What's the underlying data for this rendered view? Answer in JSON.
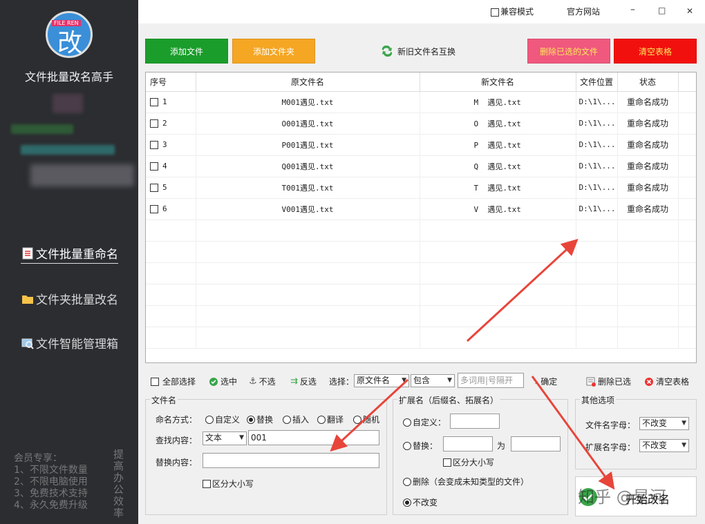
{
  "app": {
    "logo_badge": "FILE REN",
    "logo_char": "改",
    "title": "文件批量改名高手"
  },
  "nav": [
    {
      "label": "文件批量重命名",
      "icon": "document-list-icon",
      "active": true
    },
    {
      "label": "文件夹批量改名",
      "icon": "folder-icon",
      "active": false
    },
    {
      "label": "文件智能管理箱",
      "icon": "image-search-icon",
      "active": false
    }
  ],
  "member": {
    "heading": "会员专享：",
    "lines": [
      "1、不限文件数量",
      "2、不限电脑使用",
      "3、免费技术支持",
      "4、永久免费升级"
    ],
    "promo": "提高办公效率"
  },
  "titlebar": {
    "compat_label": "兼容模式",
    "website_label": "官方网站",
    "minimize": "–",
    "maximize": "□",
    "close": "✕"
  },
  "toolbar": {
    "add_file": "添加文件",
    "add_folder": "添加文件夹",
    "swap_names": "新旧文件名互换",
    "delete_selected": "删除已选的文件",
    "clear_table": "清空表格"
  },
  "table": {
    "headers": [
      "序号",
      "原文件名",
      "新文件名",
      "文件位置",
      "状态"
    ],
    "rows": [
      {
        "num": "1",
        "orig": "M001遇见.txt",
        "new_prefix": "M",
        "new_name": "遇见.txt",
        "loc": "D:\\1\\...",
        "status": "重命名成功"
      },
      {
        "num": "2",
        "orig": "O001遇见.txt",
        "new_prefix": "O",
        "new_name": "遇见.txt",
        "loc": "D:\\1\\...",
        "status": "重命名成功"
      },
      {
        "num": "3",
        "orig": "P001遇见.txt",
        "new_prefix": "P",
        "new_name": "遇见.txt",
        "loc": "D:\\1\\...",
        "status": "重命名成功"
      },
      {
        "num": "4",
        "orig": "Q001遇见.txt",
        "new_prefix": "Q",
        "new_name": "遇见.txt",
        "loc": "D:\\1\\...",
        "status": "重命名成功"
      },
      {
        "num": "5",
        "orig": "T001遇见.txt",
        "new_prefix": "T",
        "new_name": "遇见.txt",
        "loc": "D:\\1\\...",
        "status": "重命名成功"
      },
      {
        "num": "6",
        "orig": "V001遇见.txt",
        "new_prefix": "V",
        "new_name": "遇见.txt",
        "loc": "D:\\1\\...",
        "status": "重命名成功"
      }
    ]
  },
  "bottombar": {
    "select_all": "全部选择",
    "select": "选中",
    "deselect": "不选",
    "invert": "反选",
    "choose_label": "选择：",
    "field_value": "原文件名",
    "match_value": "包含",
    "keyword_placeholder": "多词用|号隔开",
    "confirm": "确定",
    "delete_selected": "删除已选",
    "clear_table": "清空表格"
  },
  "filename_panel": {
    "title": "文件名",
    "mode_label": "命名方式：",
    "modes": [
      "自定义",
      "替换",
      "插入",
      "翻译",
      "随机"
    ],
    "mode_selected": "替换",
    "find_label": "查找内容：",
    "find_type": "文本",
    "find_value": "001",
    "replace_label": "替换内容：",
    "replace_value": "",
    "case_label": "区分大小写"
  },
  "ext_panel": {
    "title": "扩展名（后缀名、拓展名）",
    "custom": "自定义：",
    "replace": "替换：",
    "to": "为",
    "case": "区分大小写",
    "delete": "删除（会变成未知类型的文件）",
    "unchanged": "不改变"
  },
  "other_panel": {
    "title": "其他选项",
    "filename_case_label": "文件名字母：",
    "filename_case_value": "不改变",
    "ext_case_label": "扩展名字母：",
    "ext_case_value": "不改变"
  },
  "start": {
    "label": "开始改名",
    "watermark": "知乎 @星河"
  },
  "colors": {
    "sidebar": "#2b2d31",
    "add_file": "#1a9d2b",
    "add_folder": "#f5a623",
    "delete_selected": "#f0587e",
    "clear_table": "#f2100e",
    "arrow": "#e8453a"
  }
}
